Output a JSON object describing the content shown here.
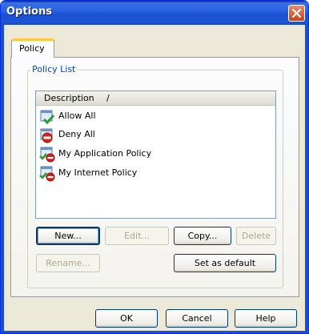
{
  "window": {
    "title": "Options",
    "close_label": "Close"
  },
  "tabs": [
    {
      "label": "Policy",
      "selected": true
    }
  ],
  "policy_list": {
    "group_label": "Policy List",
    "column_header": "Description",
    "sort_indicator": "/",
    "items": [
      {
        "label": "Allow All",
        "icon": "allow-policy-icon"
      },
      {
        "label": "Deny All",
        "icon": "deny-policy-icon"
      },
      {
        "label": "My Application Policy",
        "icon": "custom-policy-icon"
      },
      {
        "label": "My Internet Policy",
        "icon": "custom-policy-icon"
      }
    ]
  },
  "list_buttons": {
    "new": "New...",
    "edit": "Edit...",
    "copy": "Copy...",
    "delete": "Delete",
    "rename": "Rename...",
    "set_default": "Set as default"
  },
  "dialog_buttons": {
    "ok": "OK",
    "cancel": "Cancel",
    "help": "Help"
  },
  "colors": {
    "title_bar": "#1c55d6",
    "dialog_face": "#ece9d8",
    "group_label": "#0046d5",
    "tab_highlight": "#ffc83c"
  }
}
